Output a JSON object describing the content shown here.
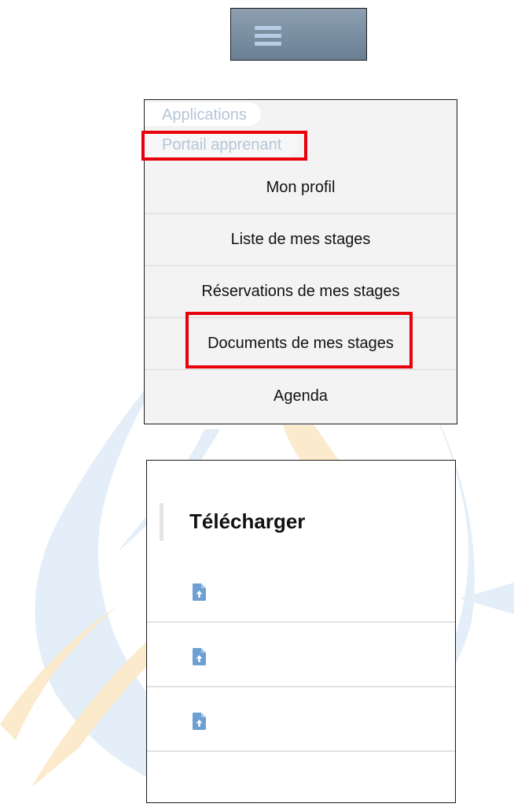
{
  "menu_button": {
    "icon": "hamburger-menu-icon"
  },
  "breadcrumb": {
    "applications_label": "Applications",
    "portail_label": "Portail apprenant"
  },
  "menu": {
    "items": [
      {
        "label": "Mon profil"
      },
      {
        "label": "Liste de mes stages"
      },
      {
        "label": "Réservations de mes stages"
      },
      {
        "label": "Documents de mes stages"
      },
      {
        "label": "Agenda"
      }
    ]
  },
  "download": {
    "title": "Télécharger",
    "files": [
      {
        "icon": "file-upload-icon"
      },
      {
        "icon": "file-upload-icon"
      },
      {
        "icon": "file-upload-icon"
      }
    ]
  },
  "colors": {
    "highlight_red": "#e8000b",
    "breadcrumb_text": "#b4c6d9",
    "file_icon_blue": "#6e9fd3",
    "watermark_blue": "#e3eef8",
    "watermark_yellow": "#fbeacb"
  }
}
